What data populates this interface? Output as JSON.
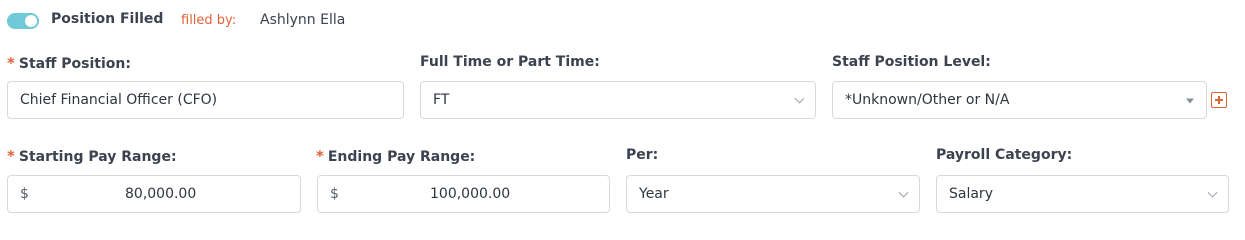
{
  "position_status": {
    "toggle_label": "Position Filled",
    "toggle_on": true,
    "filled_by_label": "filled by:",
    "filled_by_name": "Ashlynn Ella"
  },
  "row1": {
    "staff_position": {
      "label": "Staff Position:",
      "required": true,
      "value": "Chief Financial Officer (CFO)"
    },
    "full_part_time": {
      "label": "Full Time or Part Time:",
      "value": "FT"
    },
    "staff_position_level": {
      "label": "Staff Position Level:",
      "value": "*Unknown/Other or N/A"
    }
  },
  "row2": {
    "starting_pay": {
      "label": "Starting Pay Range:",
      "required": true,
      "currency": "$",
      "value": "80,000.00"
    },
    "ending_pay": {
      "label": "Ending Pay Range:",
      "required": true,
      "currency": "$",
      "value": "100,000.00"
    },
    "per": {
      "label": "Per:",
      "value": "Year"
    },
    "payroll_category": {
      "label": "Payroll Category:",
      "value": "Salary"
    }
  },
  "required_marker": "*",
  "colors": {
    "accent": "#e0623a",
    "toggle": "#6fc9d6",
    "border": "#d6d9de"
  }
}
